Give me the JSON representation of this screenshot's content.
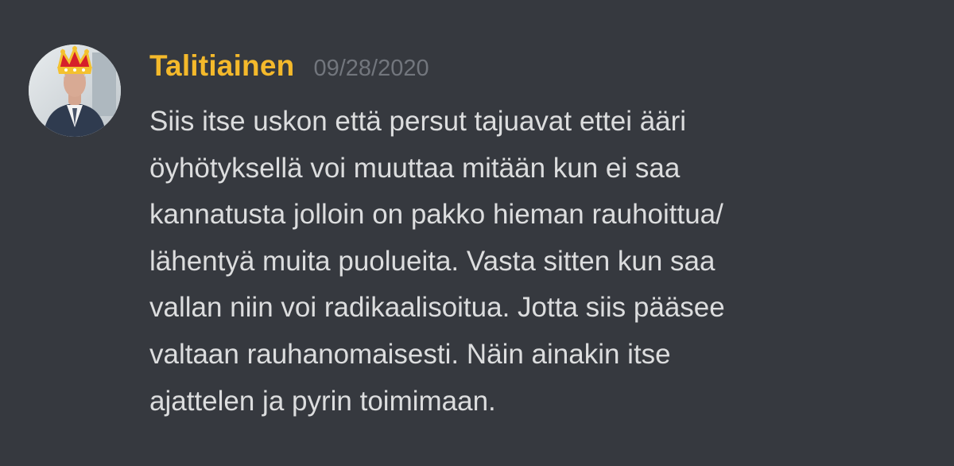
{
  "message": {
    "username": "Talitiainen",
    "timestamp": "09/28/2020",
    "avatar_icon": "crown-profile-avatar-icon",
    "lines": [
      "Siis itse uskon että persut tajuavat ettei ääri",
      "öyhötyksellä voi muuttaa mitään kun ei saa",
      "kannatusta jolloin on pakko hieman rauhoittua/",
      "lähentyä muita puolueita. Vasta sitten kun saa",
      "vallan niin voi radikaalisoitua. Jotta siis pääsee",
      "valtaan rauhanomaisesti. Näin ainakin itse",
      "ajattelen ja pyrin toimimaan."
    ]
  },
  "colors": {
    "background": "#36393f",
    "username": "#f4b92b",
    "timestamp": "#72767d",
    "text": "#dcddde"
  }
}
